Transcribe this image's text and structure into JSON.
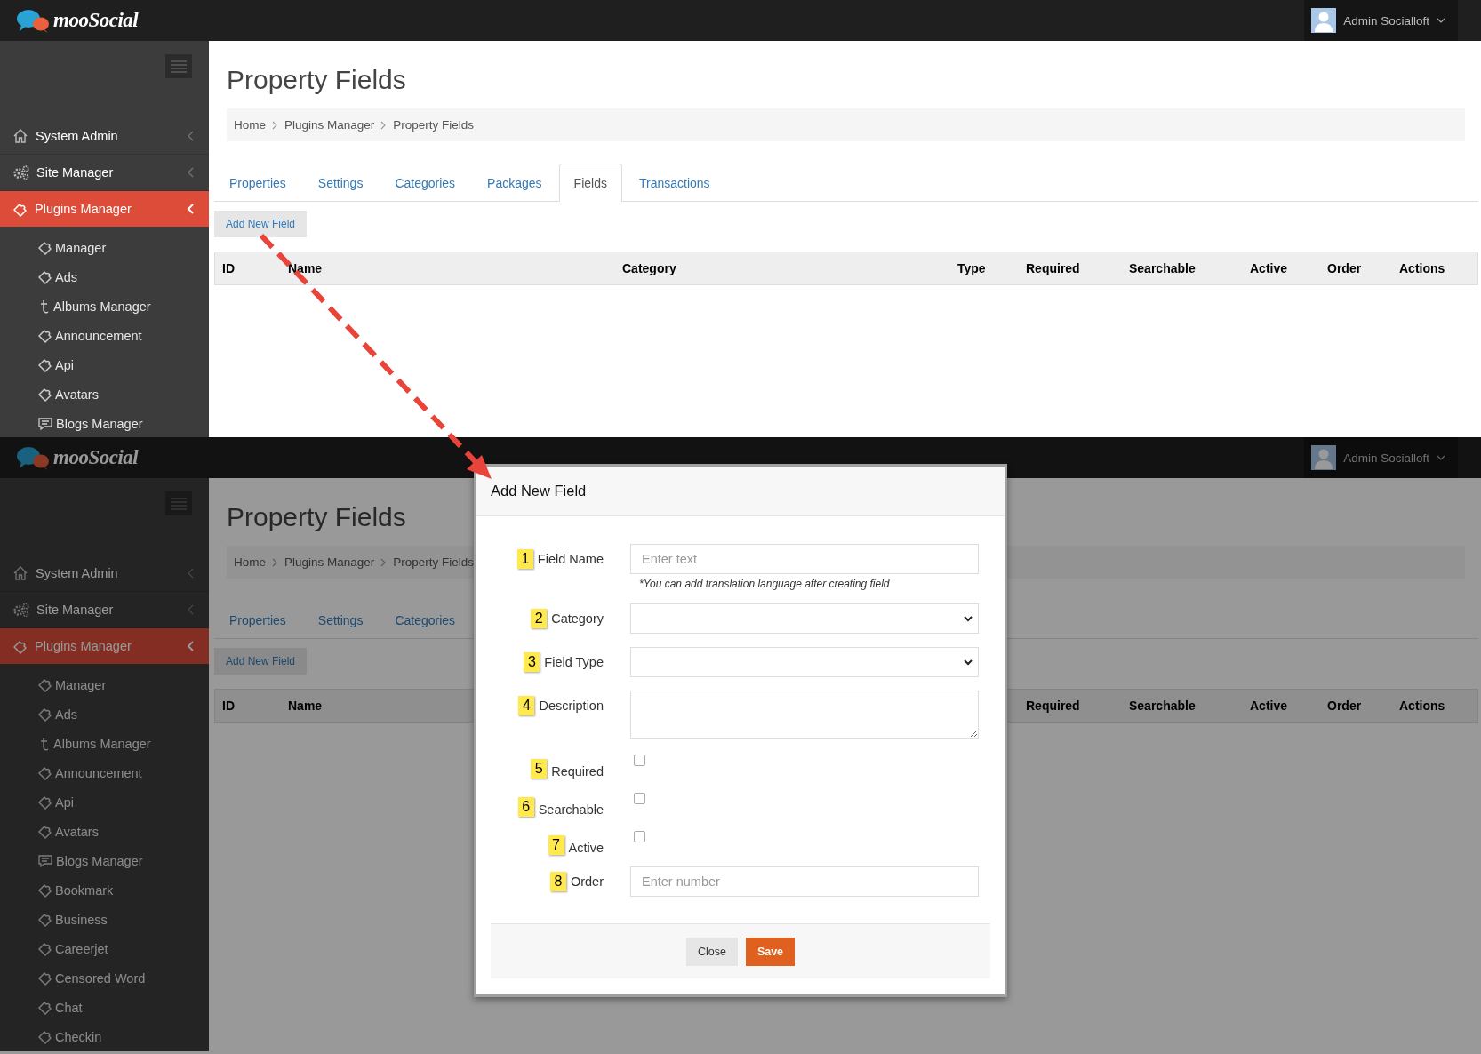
{
  "screens": [
    {
      "header": {
        "logo": "mooSocial",
        "user": "Admin Socialloft"
      },
      "sidebar": {
        "items": [
          {
            "label": "System Admin",
            "kind": "home",
            "selected": false
          },
          {
            "label": "Site Manager",
            "kind": "gears",
            "selected": false
          },
          {
            "label": "Plugins Manager",
            "kind": "plugin",
            "selected": true
          }
        ],
        "sub_items": [
          {
            "label": "Manager",
            "kind": "plugin"
          },
          {
            "label": "Ads",
            "kind": "plugin"
          },
          {
            "label": "Albums Manager",
            "kind": "album"
          },
          {
            "label": "Announcement",
            "kind": "plugin"
          },
          {
            "label": "Api",
            "kind": "plugin"
          },
          {
            "label": "Avatars",
            "kind": "plugin"
          },
          {
            "label": "Blogs Manager",
            "kind": "blog"
          }
        ]
      },
      "page": {
        "title": "Property Fields",
        "breadcrumb": [
          "Home",
          "Plugins Manager",
          "Property Fields"
        ],
        "tabs": [
          {
            "label": "Properties",
            "selected": false
          },
          {
            "label": "Settings",
            "selected": false
          },
          {
            "label": "Categories",
            "selected": false
          },
          {
            "label": "Packages",
            "selected": false
          },
          {
            "label": "Fields",
            "selected": true
          },
          {
            "label": "Transactions",
            "selected": false
          }
        ],
        "add_button": "Add New Field",
        "table": {
          "columns": [
            "ID",
            "Name",
            "Category",
            "Type",
            "Required",
            "Searchable",
            "Active",
            "Order",
            "Actions"
          ]
        }
      }
    },
    {
      "header": {
        "logo": "mooSocial",
        "user": "Admin Socialloft"
      },
      "sidebar": {
        "items": [
          {
            "label": "System Admin",
            "kind": "home",
            "selected": false
          },
          {
            "label": "Site Manager",
            "kind": "gears",
            "selected": false
          },
          {
            "label": "Plugins Manager",
            "kind": "plugin",
            "selected": true
          }
        ],
        "sub_items": [
          {
            "label": "Manager",
            "kind": "plugin"
          },
          {
            "label": "Ads",
            "kind": "plugin"
          },
          {
            "label": "Albums Manager",
            "kind": "album"
          },
          {
            "label": "Announcement",
            "kind": "plugin"
          },
          {
            "label": "Api",
            "kind": "plugin"
          },
          {
            "label": "Avatars",
            "kind": "plugin"
          },
          {
            "label": "Blogs Manager",
            "kind": "blog"
          },
          {
            "label": "Bookmark",
            "kind": "plugin"
          },
          {
            "label": "Business",
            "kind": "plugin"
          },
          {
            "label": "Careerjet",
            "kind": "plugin"
          },
          {
            "label": "Censored Word",
            "kind": "plugin"
          },
          {
            "label": "Chat",
            "kind": "plugin"
          },
          {
            "label": "Checkin",
            "kind": "plugin"
          }
        ]
      },
      "page": {
        "title": "Property Fields",
        "breadcrumb": [
          "Home",
          "Plugins Manager",
          "Property Fields"
        ],
        "tabs": [
          {
            "label": "Properties",
            "selected": false
          },
          {
            "label": "Settings",
            "selected": false
          },
          {
            "label": "Categories",
            "selected": false
          }
        ],
        "add_button": "Add New Field",
        "table": {
          "columns": [
            "ID",
            "Name",
            "Required",
            "Searchable",
            "Active",
            "Order",
            "Actions"
          ]
        }
      },
      "modal": {
        "title": "Add New Field",
        "fields": [
          {
            "number": "1",
            "label": "Field Name",
            "kind": "text",
            "placeholder": "Enter text",
            "hint": "*You can add translation language after creating field"
          },
          {
            "number": "2",
            "label": "Category",
            "kind": "select"
          },
          {
            "number": "3",
            "label": "Field Type",
            "kind": "select"
          },
          {
            "number": "4",
            "label": "Description",
            "kind": "textarea"
          },
          {
            "number": "5",
            "label": "Required",
            "kind": "checkbox",
            "checked": false
          },
          {
            "number": "6",
            "label": "Searchable",
            "kind": "checkbox",
            "checked": false
          },
          {
            "number": "7",
            "label": "Active",
            "kind": "checkbox",
            "checked": false
          },
          {
            "number": "8",
            "label": "Order",
            "kind": "number",
            "placeholder": "Enter number"
          }
        ],
        "buttons": [
          {
            "label": "Close",
            "kind": "secondary"
          },
          {
            "label": "Save",
            "kind": "primary"
          }
        ]
      }
    }
  ]
}
